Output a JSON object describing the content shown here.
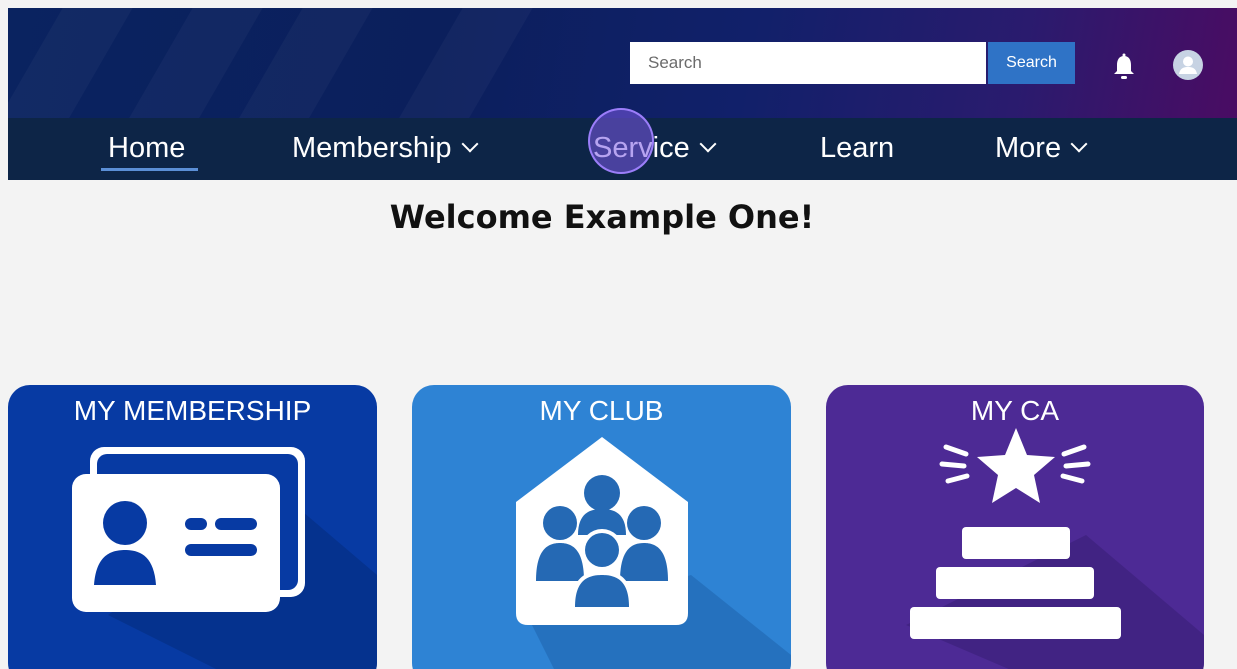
{
  "header": {
    "search_placeholder": "Search",
    "search_button": "Search"
  },
  "nav": {
    "items": [
      {
        "label": "Home"
      },
      {
        "label": "Membership"
      },
      {
        "label": "Service"
      },
      {
        "label": "Learn"
      },
      {
        "label": "More"
      }
    ]
  },
  "main": {
    "welcome": "Welcome Example One!"
  },
  "cards": [
    {
      "title": "MY MEMBERSHIP"
    },
    {
      "title": "MY CLUB"
    },
    {
      "title": "MY CA"
    }
  ],
  "colors": {
    "nav_bg": "#0d2547",
    "accent": "#2f73c6",
    "membership_card": "#073aa3",
    "club_card": "#2e83d4",
    "ca_card": "#4d2a95"
  },
  "icons": [
    "bell-icon",
    "avatar-icon",
    "chevron-down-icon",
    "id-card-icon",
    "community-house-icon",
    "star-podium-icon"
  ]
}
